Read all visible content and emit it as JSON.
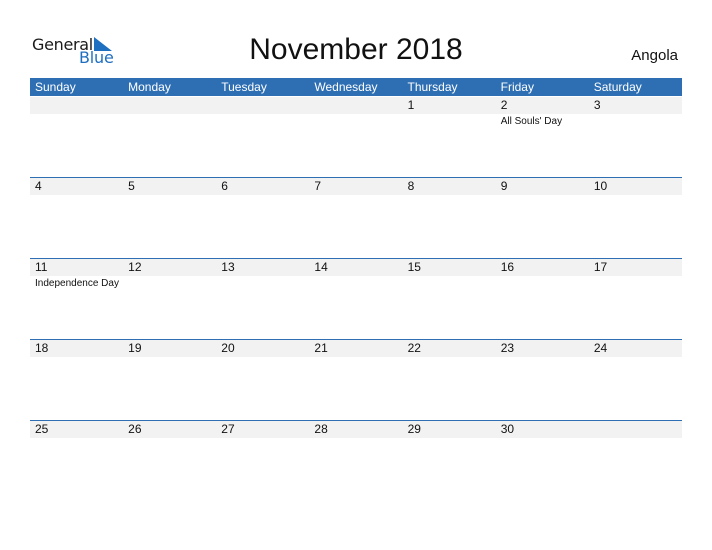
{
  "logo": {
    "text_general": "General",
    "text_blue": "Blue",
    "icon": "triangle-flag-icon"
  },
  "title": "November 2018",
  "country": "Angola",
  "colors": {
    "header_bg": "#2e6fb4",
    "band_bg": "#f2f2f2",
    "brand_blue": "#1f6fc0"
  },
  "weekdays": [
    "Sunday",
    "Monday",
    "Tuesday",
    "Wednesday",
    "Thursday",
    "Friday",
    "Saturday"
  ],
  "weeks": [
    {
      "days": [
        {
          "num": "",
          "holiday": ""
        },
        {
          "num": "",
          "holiday": ""
        },
        {
          "num": "",
          "holiday": ""
        },
        {
          "num": "",
          "holiday": ""
        },
        {
          "num": "1",
          "holiday": ""
        },
        {
          "num": "2",
          "holiday": "All Souls' Day"
        },
        {
          "num": "3",
          "holiday": ""
        }
      ]
    },
    {
      "days": [
        {
          "num": "4",
          "holiday": ""
        },
        {
          "num": "5",
          "holiday": ""
        },
        {
          "num": "6",
          "holiday": ""
        },
        {
          "num": "7",
          "holiday": ""
        },
        {
          "num": "8",
          "holiday": ""
        },
        {
          "num": "9",
          "holiday": ""
        },
        {
          "num": "10",
          "holiday": ""
        }
      ]
    },
    {
      "days": [
        {
          "num": "11",
          "holiday": "Independence Day"
        },
        {
          "num": "12",
          "holiday": ""
        },
        {
          "num": "13",
          "holiday": ""
        },
        {
          "num": "14",
          "holiday": ""
        },
        {
          "num": "15",
          "holiday": ""
        },
        {
          "num": "16",
          "holiday": ""
        },
        {
          "num": "17",
          "holiday": ""
        }
      ]
    },
    {
      "days": [
        {
          "num": "18",
          "holiday": ""
        },
        {
          "num": "19",
          "holiday": ""
        },
        {
          "num": "20",
          "holiday": ""
        },
        {
          "num": "21",
          "holiday": ""
        },
        {
          "num": "22",
          "holiday": ""
        },
        {
          "num": "23",
          "holiday": ""
        },
        {
          "num": "24",
          "holiday": ""
        }
      ]
    },
    {
      "days": [
        {
          "num": "25",
          "holiday": ""
        },
        {
          "num": "26",
          "holiday": ""
        },
        {
          "num": "27",
          "holiday": ""
        },
        {
          "num": "28",
          "holiday": ""
        },
        {
          "num": "29",
          "holiday": ""
        },
        {
          "num": "30",
          "holiday": ""
        },
        {
          "num": "",
          "holiday": ""
        }
      ]
    }
  ]
}
